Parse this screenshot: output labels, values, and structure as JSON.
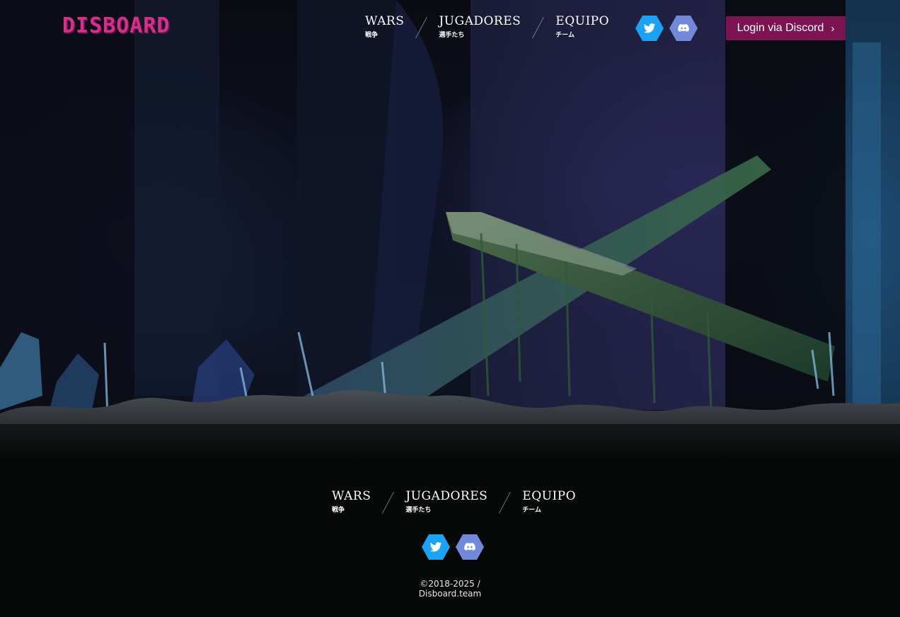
{
  "header": {
    "logo_text": "DISBOARD",
    "login_label": "Login via Discord",
    "login_chevron": "›"
  },
  "nav": [
    {
      "label": "WARS",
      "sub": "戦争"
    },
    {
      "label": "JUGADORES",
      "sub": "選手たち"
    },
    {
      "label": "EQUIPO",
      "sub": "チーム"
    }
  ],
  "social": {
    "twitter_icon": "twitter-icon",
    "discord_icon": "discord-icon",
    "twitter_color": "#1da1f2",
    "discord_color": "#7289da"
  },
  "footer": {
    "copyright_line1": "©2018-2025 /",
    "copyright_line2": "Disboard.team"
  },
  "colors": {
    "brand": "#d2308a",
    "login_bg": "#7b1451",
    "page_bg": "#070909"
  }
}
